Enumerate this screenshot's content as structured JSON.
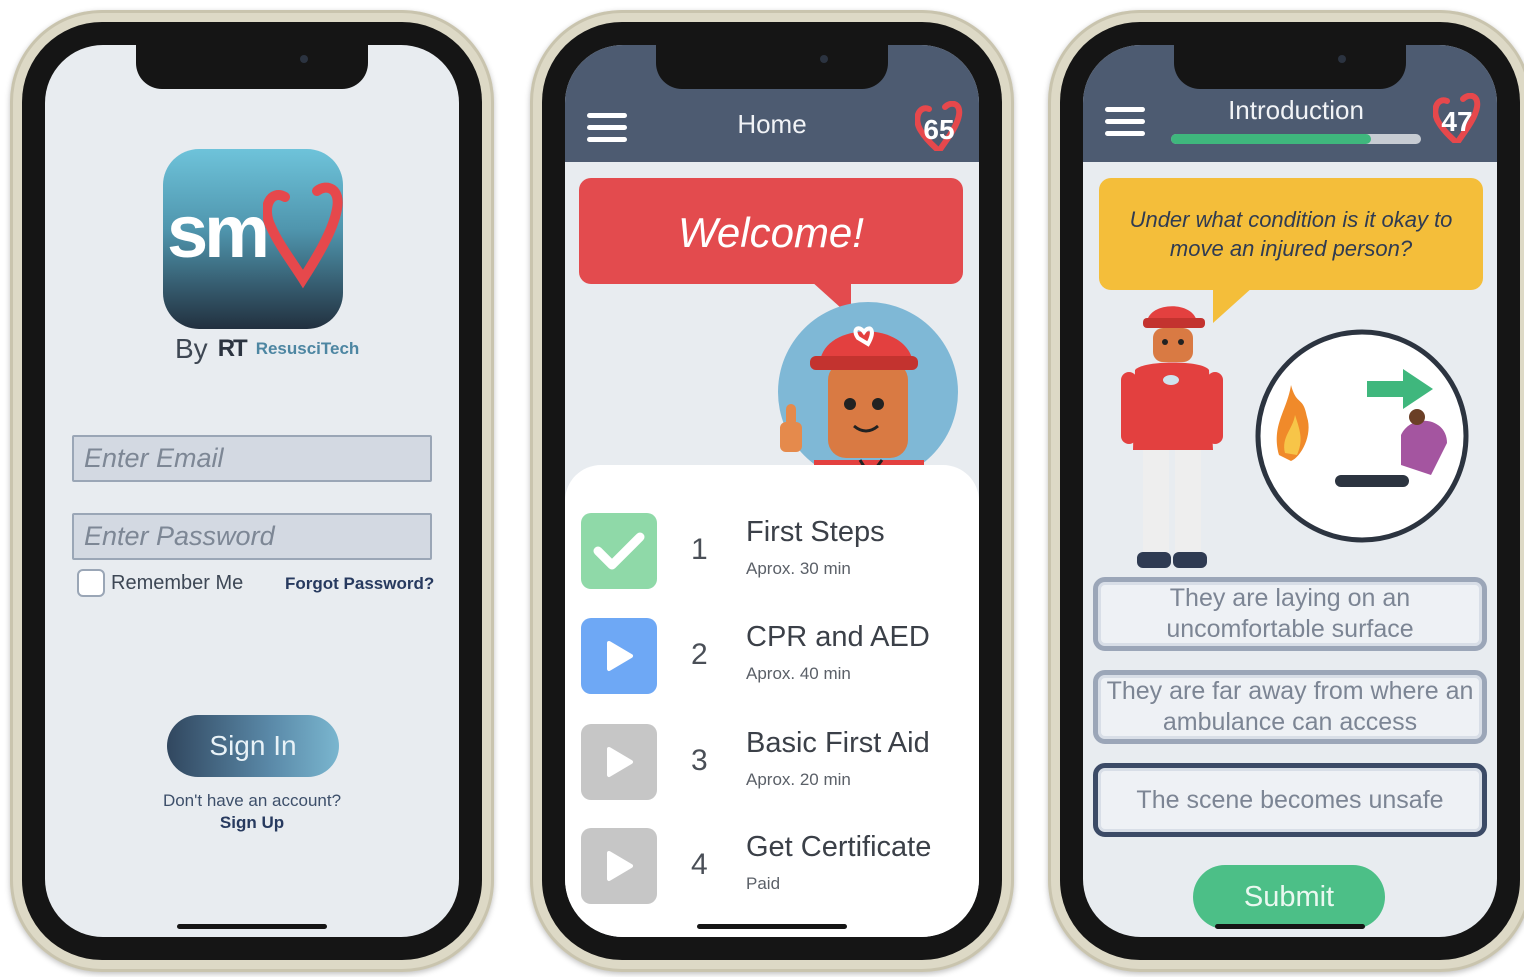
{
  "login": {
    "logo_text": "sm",
    "by_label": "By",
    "company_mark": "RT",
    "company_name": "ResusciTech",
    "email_placeholder": "Enter Email",
    "password_placeholder": "Enter Password",
    "remember_label": "Remember Me",
    "forgot_label": "Forgot Password?",
    "signin_label": "Sign In",
    "no_account_text": "Don't have an account?",
    "signup_label": "Sign Up"
  },
  "home": {
    "header_title": "Home",
    "lives": "65",
    "welcome_text": "Welcome!",
    "lessons": [
      {
        "number": "1",
        "title": "First Steps",
        "time": "Aprox. 30 min",
        "status": "complete",
        "icon": "check-icon"
      },
      {
        "number": "2",
        "title": "CPR and AED",
        "time": "Aprox. 40 min",
        "status": "current",
        "icon": "play-icon"
      },
      {
        "number": "3",
        "title": "Basic First Aid",
        "time": "Aprox. 20 min",
        "status": "locked",
        "icon": "play-icon"
      },
      {
        "number": "4",
        "title": "Get Certificate",
        "time": "Paid",
        "status": "locked",
        "icon": "play-icon"
      }
    ]
  },
  "quiz": {
    "header_title": "Introduction",
    "lives": "47",
    "progress": 0.8,
    "question": "Under what condition is it okay to move an injured person?",
    "answers": [
      {
        "text": "They are laying on an uncomfortable surface",
        "selected": false
      },
      {
        "text": "They are far away from where an ambulance can access",
        "selected": false
      },
      {
        "text": "The scene becomes unsafe",
        "selected": true
      }
    ],
    "submit_label": "Submit"
  },
  "colors": {
    "header": "#4d5b71",
    "welcome": "#e34b4e",
    "question": "#f4be3a",
    "complete": "#8fd9a8",
    "current": "#6ea8f5",
    "locked": "#c6c6c6",
    "submit": "#4cbf87"
  }
}
